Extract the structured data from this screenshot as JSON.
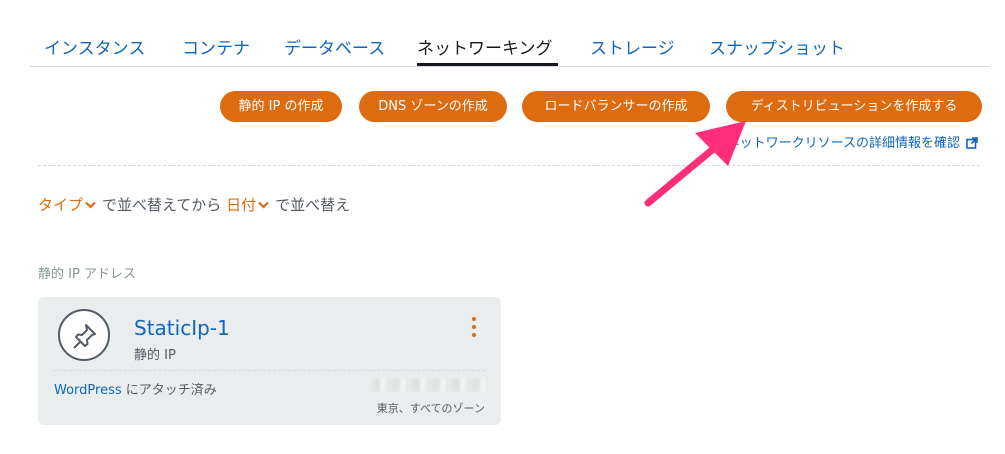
{
  "tabs": [
    {
      "label": "インスタンス"
    },
    {
      "label": "コンテナ"
    },
    {
      "label": "データベース"
    },
    {
      "label": "ネットワーキング"
    },
    {
      "label": "ストレージ"
    },
    {
      "label": "スナップショット"
    }
  ],
  "actions": {
    "create_static_ip": "静的 IP の作成",
    "create_dns_zone": "DNS ゾーンの作成",
    "create_load_balancer": "ロードバランサーの作成",
    "create_distribution": "ディストリビューションを作成する",
    "learn_more": "ネットワークリソースの詳細情報を確認"
  },
  "sort": {
    "first_key": "タイプ",
    "mid_text": "で並べ替えてから",
    "second_key": "日付",
    "end_text": "で並べ替え"
  },
  "section": {
    "label": "静的 IP アドレス"
  },
  "static_ip": {
    "name": "StaticIp-1",
    "type": "静的 IP",
    "attached_target": "WordPress",
    "attached_suffix": " にアタッチ済み",
    "region": "東京、すべてのゾーン"
  },
  "colors": {
    "accent": "#dd6b10",
    "link": "#1166bb",
    "annotation_arrow": "#ff2d7a"
  },
  "icons": {
    "pin": "pin-icon",
    "kebab": "more-vertical-icon",
    "external": "external-link-icon",
    "chevron": "chevron-down-icon"
  }
}
